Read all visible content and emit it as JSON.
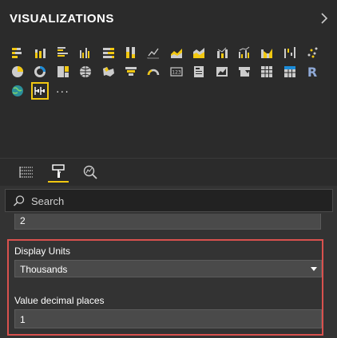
{
  "panel": {
    "title": "VISUALIZATIONS"
  },
  "visuals": {
    "icons": [
      "stacked-bar-chart-icon",
      "stacked-column-chart-icon",
      "clustered-bar-chart-icon",
      "clustered-column-chart-icon",
      "100-stacked-bar-chart-icon",
      "100-stacked-column-chart-icon",
      "line-chart-icon",
      "area-chart-icon",
      "stacked-area-chart-icon",
      "line-and-stacked-column-icon",
      "line-and-clustered-column-icon",
      "ribbon-chart-icon",
      "waterfall-chart-icon",
      "scatter-chart-icon",
      "pie-chart-icon",
      "donut-chart-icon",
      "treemap-icon",
      "map-icon",
      "filled-map-icon",
      "funnel-icon",
      "gauge-icon",
      "card-icon",
      "multi-row-card-icon",
      "kpi-icon",
      "slicer-icon",
      "table-icon",
      "matrix-icon",
      "r-script-visual-icon",
      "globe-map-icon",
      "custom-visual-icon",
      "more-visuals-icon"
    ],
    "more_label": "···",
    "r_label": "R"
  },
  "tabs": [
    {
      "name": "fields-tab"
    },
    {
      "name": "format-tab"
    },
    {
      "name": "analytics-tab"
    }
  ],
  "search": {
    "placeholder": "Search"
  },
  "format": {
    "top_value": "2",
    "display_units_label": "Display Units",
    "display_units_value": "Thousands",
    "decimal_label": "Value decimal places",
    "decimal_value": "1"
  },
  "colors": {
    "accent": "#f2c811",
    "highlight": "#d9514e",
    "panel_bg": "#2b2b2b",
    "content_bg": "#333333"
  }
}
